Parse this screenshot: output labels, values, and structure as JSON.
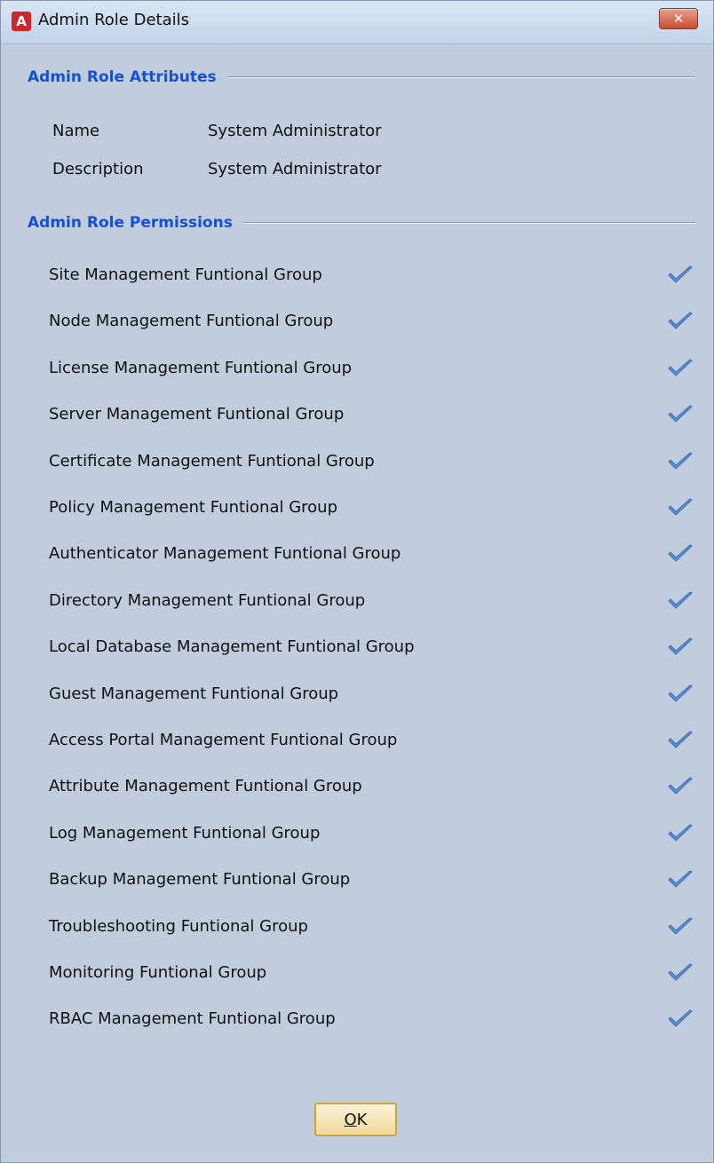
{
  "window": {
    "title": "Admin Role Details",
    "app_icon_letter": "A",
    "close_glyph": "✕"
  },
  "attributes": {
    "header": "Admin Role Attributes",
    "rows": [
      {
        "label": "Name",
        "value": "System Administrator"
      },
      {
        "label": "Description",
        "value": "System Administrator"
      }
    ]
  },
  "permissions": {
    "header": "Admin Role Permissions",
    "check_icon": "check-icon",
    "check_color": "#5a8fd6",
    "items": [
      {
        "label": "Site Management Funtional Group",
        "granted": true
      },
      {
        "label": "Node Management Funtional Group",
        "granted": true
      },
      {
        "label": "License Management Funtional Group",
        "granted": true
      },
      {
        "label": "Server Management Funtional Group",
        "granted": true
      },
      {
        "label": "Certificate Management Funtional Group",
        "granted": true
      },
      {
        "label": "Policy Management Funtional Group",
        "granted": true
      },
      {
        "label": "Authenticator Management Funtional Group",
        "granted": true
      },
      {
        "label": "Directory Management Funtional Group",
        "granted": true
      },
      {
        "label": "Local Database Management Funtional Group",
        "granted": true
      },
      {
        "label": "Guest Management Funtional Group",
        "granted": true
      },
      {
        "label": "Access Portal Management Funtional Group",
        "granted": true
      },
      {
        "label": "Attribute Management Funtional Group",
        "granted": true
      },
      {
        "label": "Log Management Funtional Group",
        "granted": true
      },
      {
        "label": "Backup  Management Funtional Group",
        "granted": true
      },
      {
        "label": "Troubleshooting Funtional Group",
        "granted": true
      },
      {
        "label": "Monitoring Funtional Group",
        "granted": true
      },
      {
        "label": "RBAC Management Funtional Group",
        "granted": true
      }
    ]
  },
  "footer": {
    "ok_label": "OK",
    "ok_mnemonic": "O"
  }
}
